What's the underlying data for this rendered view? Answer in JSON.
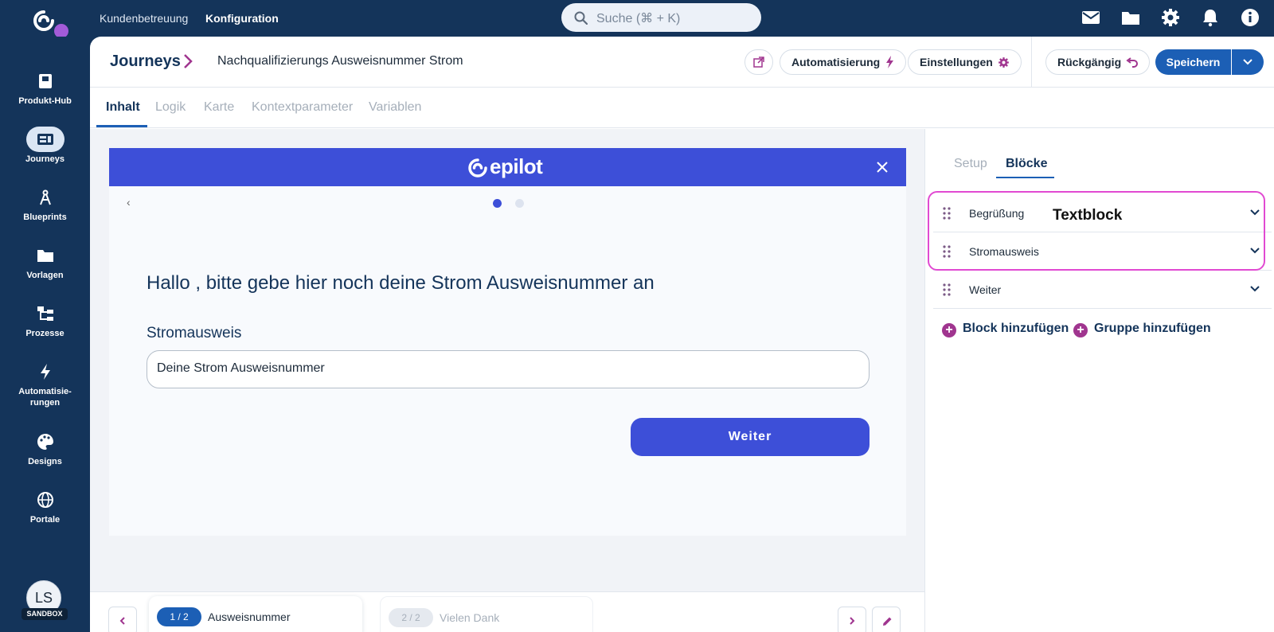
{
  "topbar": {
    "nav": [
      "Kundenbetreuung",
      "Konfiguration"
    ],
    "search_placeholder": "Suche (⌘ + K)",
    "icons": [
      "mail-icon",
      "folder-icon",
      "gear-icon",
      "bell-icon",
      "info-icon"
    ]
  },
  "sidebar": {
    "items": [
      {
        "label": "Produkt-Hub",
        "icon": "product-hub-icon"
      },
      {
        "label": "Journeys",
        "icon": "journeys-icon",
        "active": true
      },
      {
        "label": "Blueprints",
        "icon": "blueprints-icon"
      },
      {
        "label": "Vorlagen",
        "icon": "folder-icon"
      },
      {
        "label": "Prozesse",
        "icon": "processes-icon"
      },
      {
        "label": "Automatisie-\nrungen",
        "icon": "lightning-icon"
      },
      {
        "label": "Designs",
        "icon": "palette-icon"
      },
      {
        "label": "Portale",
        "icon": "globe-icon"
      }
    ],
    "avatar_initials": "LS",
    "sandbox_badge": "SANDBOX"
  },
  "header": {
    "breadcrumb": "Journeys",
    "journey_title": "Nachqualifizierungs Ausweisnummer Strom",
    "automation_button": "Automatisierung",
    "settings_button": "Einstellungen",
    "undo_button": "Rückgängig",
    "save_button": "Speichern"
  },
  "tabs": [
    "Inhalt",
    "Logik",
    "Karte",
    "Kontextparameter",
    "Variablen"
  ],
  "preview": {
    "brand": "epilot",
    "back_glyph": "‹",
    "heading": "Hallo , bitte gebe hier noch deine Strom Ausweisnummer an",
    "field_label": "Stromausweis",
    "field_value": "Deine Strom Ausweisnummer",
    "button": "Weiter"
  },
  "steps": [
    {
      "badge": "1 / 2",
      "name": "Ausweisnummer"
    },
    {
      "badge": "2 / 2",
      "name": "Vielen Dank"
    }
  ],
  "right_panel": {
    "tabs": [
      "Setup",
      "Blöcke"
    ],
    "blocks": [
      "Begrüßung",
      "Stromausweis",
      "Weiter"
    ],
    "tooltip": "Textblock",
    "add_block": "Block hinzufügen",
    "add_group": "Gruppe hinzufügen"
  },
  "colors": {
    "navy": "#14345a",
    "brand_blue": "#3d4fd8",
    "save_blue": "#1c5fb5",
    "highlight_pink": "#e14ad2",
    "plus_purple": "#a0358f"
  }
}
